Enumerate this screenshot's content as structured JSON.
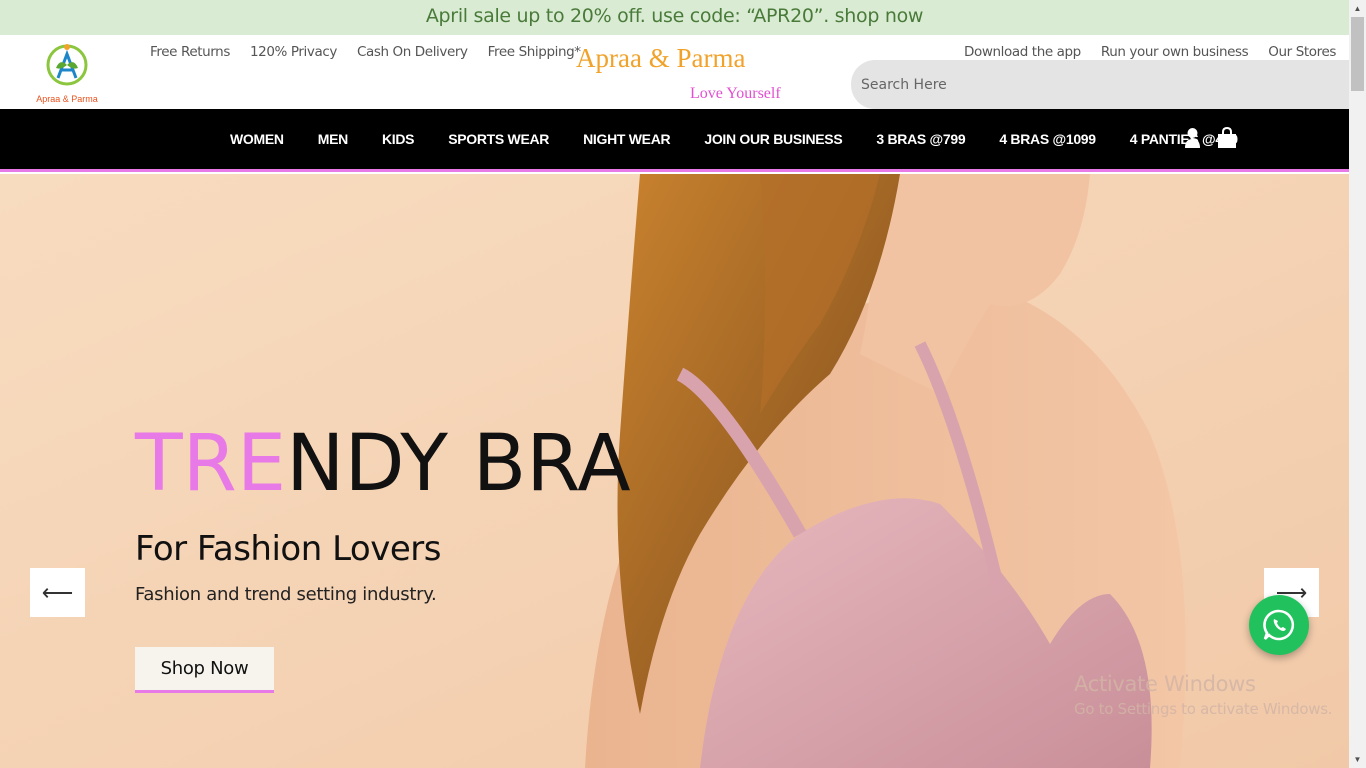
{
  "promo": {
    "text": "April sale up to 20% off. use code: “APR20”. shop now"
  },
  "header": {
    "logo_text": "Apraa & Parma",
    "links": [
      "Free Returns",
      "120% Privacy",
      "Cash On Delivery",
      "Free Shipping*"
    ],
    "brand": "Apraa & Parma",
    "tagline": "Love Yourself",
    "right_links": [
      "Download the app",
      "Run your own business",
      "Our Stores"
    ],
    "search_placeholder": "Search Here"
  },
  "nav": {
    "items": [
      "WOMEN",
      "MEN",
      "KIDS",
      "SPORTS WEAR",
      "NIGHT WEAR",
      "JOIN OUR BUSINESS",
      "3 BRAS @799",
      "4 BRAS @1099",
      "4 PANTIES @499"
    ],
    "icons": [
      "user-icon",
      "shopping-bag-icon"
    ]
  },
  "hero": {
    "title_highlight": "TRE",
    "title_rest": "NDY BRA",
    "subtitle": "For Fashion Lovers",
    "description": "Fashion and trend setting industry.",
    "cta": "Shop Now",
    "prev_arrow": "⟵",
    "next_arrow": "⟶"
  },
  "watermark": {
    "line1": "Activate Windows",
    "line2": "Go to Settings to activate Windows."
  },
  "colors": {
    "accent_pink": "#e77ae6",
    "brand_orange": "#f1a22a",
    "promo_bg": "#d9ecd3",
    "whatsapp_green": "#21c25e"
  }
}
